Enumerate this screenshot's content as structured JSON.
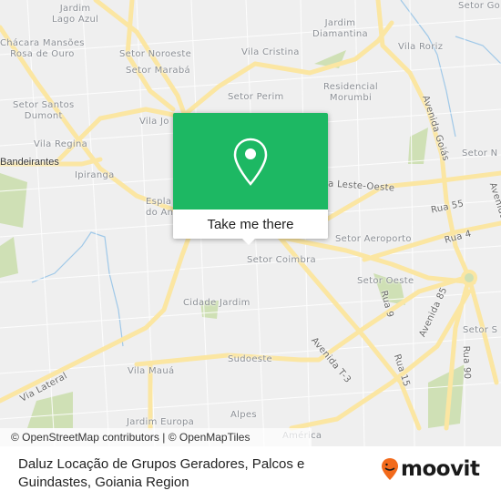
{
  "map": {
    "labels": [
      {
        "id": "jardim-lago-azul",
        "text": "Jardim\nLago Azul"
      },
      {
        "id": "chacara",
        "text": "Chácara Mansões\nRosa de Ouro"
      },
      {
        "id": "setor-noroeste",
        "text": "Setor Noroeste"
      },
      {
        "id": "setor-maraba",
        "text": "Setor Marabá"
      },
      {
        "id": "setor-santos-dumont",
        "text": "Setor Santos\nDumont"
      },
      {
        "id": "vila-regina",
        "text": "Vila Regina"
      },
      {
        "id": "bandeirantes",
        "text": "Bandeirantes"
      },
      {
        "id": "ipiranga",
        "text": "Ipiranga"
      },
      {
        "id": "vila-joao",
        "text": "Vila Jo"
      },
      {
        "id": "espla",
        "text": "Espla\ndo An"
      },
      {
        "id": "jardim-diamantina",
        "text": "Jardim\nDiamantina"
      },
      {
        "id": "vila-cristina",
        "text": "Vila Cristina"
      },
      {
        "id": "vila-roriz",
        "text": "Vila Roriz"
      },
      {
        "id": "setor-perim",
        "text": "Setor Perim"
      },
      {
        "id": "residencial-morumbi",
        "text": "Residencial\nMorumbi"
      },
      {
        "id": "setor-go",
        "text": "Setor Go"
      },
      {
        "id": "setor-n",
        "text": "Setor N"
      },
      {
        "id": "avenida-goias",
        "text": "Avenida Goiás"
      },
      {
        "id": "leste-oeste",
        "text": "a Leste-Oeste"
      },
      {
        "id": "rua-55",
        "text": "Rua 55"
      },
      {
        "id": "avenida-e",
        "text": "Avenida"
      },
      {
        "id": "setor-aeroporto",
        "text": "Setor Aeroporto"
      },
      {
        "id": "rua-4",
        "text": "Rua 4"
      },
      {
        "id": "setor-coimbra",
        "text": "Setor Coimbra"
      },
      {
        "id": "setor-oeste",
        "text": "Setor Oeste"
      },
      {
        "id": "rua-9",
        "text": "Rua 9"
      },
      {
        "id": "avenida-85",
        "text": "Avenida 85"
      },
      {
        "id": "setor-s",
        "text": "Setor S"
      },
      {
        "id": "cidade-jardim",
        "text": "Cidade Jardim"
      },
      {
        "id": "avenida-t3",
        "text": "Avenida T-3"
      },
      {
        "id": "rua-15",
        "text": "Rua 15"
      },
      {
        "id": "rua-90",
        "text": "Rua 90"
      },
      {
        "id": "sudoeste",
        "text": "Sudoeste"
      },
      {
        "id": "vila-maua",
        "text": "Vila Mauá"
      },
      {
        "id": "via-lateral",
        "text": "Via Lateral"
      },
      {
        "id": "alpes",
        "text": "Alpes"
      },
      {
        "id": "jardim-europa",
        "text": "Jardim Europa"
      },
      {
        "id": "america",
        "text": "América"
      }
    ],
    "colors": {
      "background": "#efefef",
      "road": "#fbe6a2",
      "park": "#cfe0b5",
      "water": "#9fc8e8"
    }
  },
  "popup": {
    "icon": "map-pin-icon",
    "button_label": "Take me there",
    "color": "#1db863"
  },
  "attribution": "© OpenStreetMap contributors | © OpenMapTiles",
  "footer": {
    "place_title": "Daluz Locação de Grupos Geradores, Palcos e Guindastes, Goiania Region",
    "logo_text": "moovit",
    "logo_color": "#f26a1b"
  }
}
